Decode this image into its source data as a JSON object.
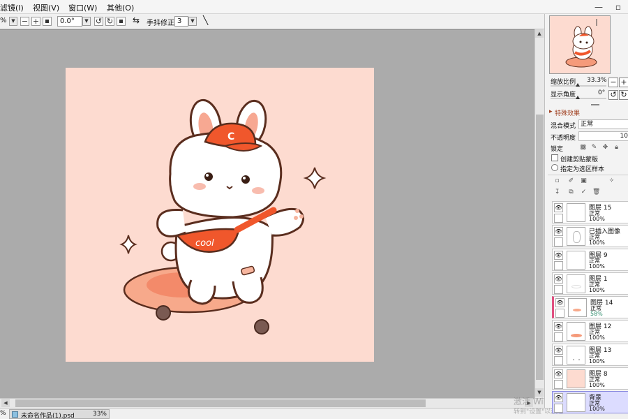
{
  "menu": {
    "items": [
      "滤镜(I)",
      "视图(V)",
      "窗口(W)",
      "其他(O)"
    ],
    "minimize_label": "—",
    "restore_label": "▫"
  },
  "tool_options": {
    "zoom_label": "%",
    "rotation_value": "0.0°",
    "stabilizer_label": "手抖修正",
    "stabilizer_value": "3",
    "plus_label": "+",
    "minus_label": "−"
  },
  "canvas": {
    "background_color": "#fddbd0",
    "artwork": {
      "cap_letter": "C",
      "bag_text": "cool"
    }
  },
  "status_bar": {
    "left_percent": "%",
    "document_name": "未命名作品(1).psd",
    "zoom": "33%",
    "watermark_line1": "激活 Windows",
    "watermark_line2": "转到\"设置\"以激活 Windows。"
  },
  "navigator": {
    "zoom_label": "缩放比例",
    "zoom_value": "33.3%",
    "angle_label": "显示角度",
    "angle_value": "0°"
  },
  "layer_properties": {
    "section_title": "特殊效果",
    "blend_mode_label": "混合模式",
    "blend_mode_value": "正常",
    "opacity_label": "不透明度",
    "opacity_value": "10",
    "lock_label": "锁定",
    "clip_label": "创建剪贴蒙版",
    "selection_source_label": "指定为选区样本"
  },
  "layers": [
    {
      "name": "图层 15",
      "mode": "正常",
      "opacity": "100%",
      "selected": false,
      "active": false,
      "thumb": "blank"
    },
    {
      "name": "已插入图像",
      "mode": "正常",
      "opacity": "100%",
      "selected": false,
      "active": false,
      "thumb": "outline"
    },
    {
      "name": "图层 9",
      "mode": "正常",
      "opacity": "100%",
      "selected": false,
      "active": false,
      "thumb": "blank"
    },
    {
      "name": "图层 1",
      "mode": "正常",
      "opacity": "100%",
      "selected": false,
      "active": false,
      "thumb": "sketch"
    },
    {
      "name": "图层 14",
      "mode": "正常",
      "opacity": "58%",
      "selected": false,
      "active": true,
      "thumb": "shadow"
    },
    {
      "name": "图层 12",
      "mode": "正常",
      "opacity": "100%",
      "selected": false,
      "active": false,
      "thumb": "board"
    },
    {
      "name": "图层 13",
      "mode": "正常",
      "opacity": "100%",
      "selected": false,
      "active": false,
      "thumb": "dots"
    },
    {
      "name": "图层 8",
      "mode": "正常",
      "opacity": "100%",
      "selected": false,
      "active": false,
      "thumb": "pink"
    },
    {
      "name": "背景",
      "mode": "正常",
      "opacity": "100%",
      "selected": true,
      "active": false,
      "thumb": "white"
    }
  ],
  "colors": {
    "workspace": "#ababab",
    "canvas_bg": "#fddbd0",
    "cap_orange": "#f0572c",
    "board_salmon": "#f59a7a",
    "outline_brown": "#5a2d1e",
    "active_marker": "#e05080"
  }
}
